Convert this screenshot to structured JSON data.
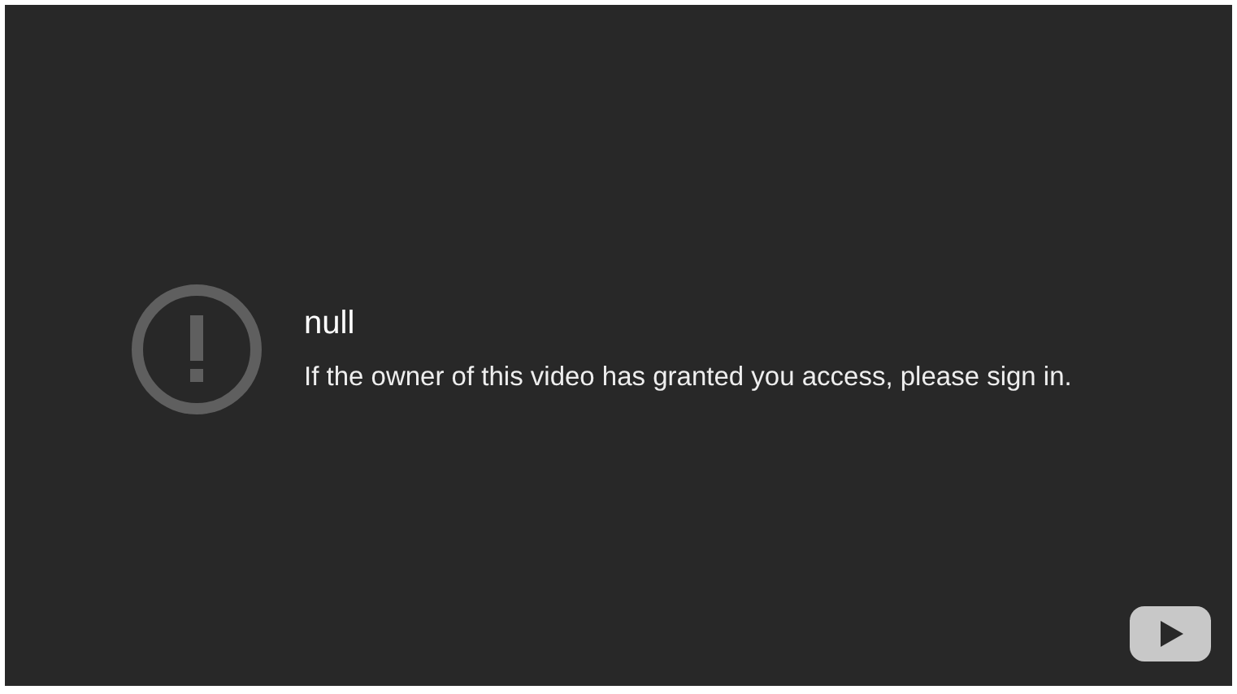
{
  "error": {
    "title": "null",
    "message": "If the owner of this video has granted you access, please sign in."
  }
}
